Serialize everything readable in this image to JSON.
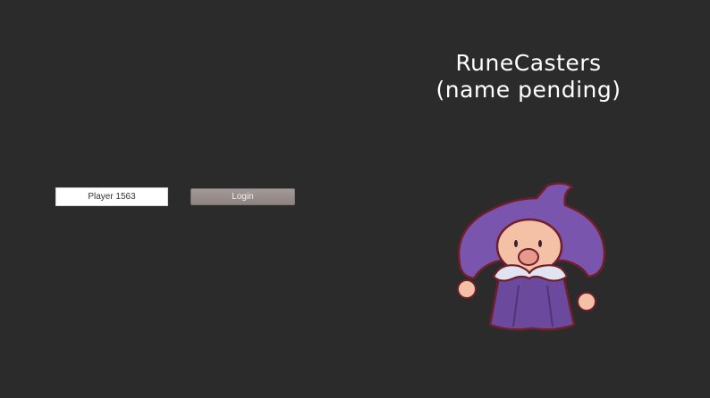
{
  "window": {
    "title_line1": "RuneCasters",
    "title_line2": "(name pending)"
  },
  "login_form": {
    "player_name_value": "Player 1563",
    "login_label": "Login"
  },
  "mascot": {
    "icon": "wizard-mascot-icon",
    "colors": {
      "hat": "#7a55ae",
      "robe": "#6b4a9e",
      "skin": "#f4c1a6",
      "beard": "#dfe4f0",
      "outline": "#6e1f2a"
    }
  },
  "colors": {
    "background": "#2b2b2b",
    "title_text": "#ffffff",
    "button_bg": "#978e8c"
  }
}
